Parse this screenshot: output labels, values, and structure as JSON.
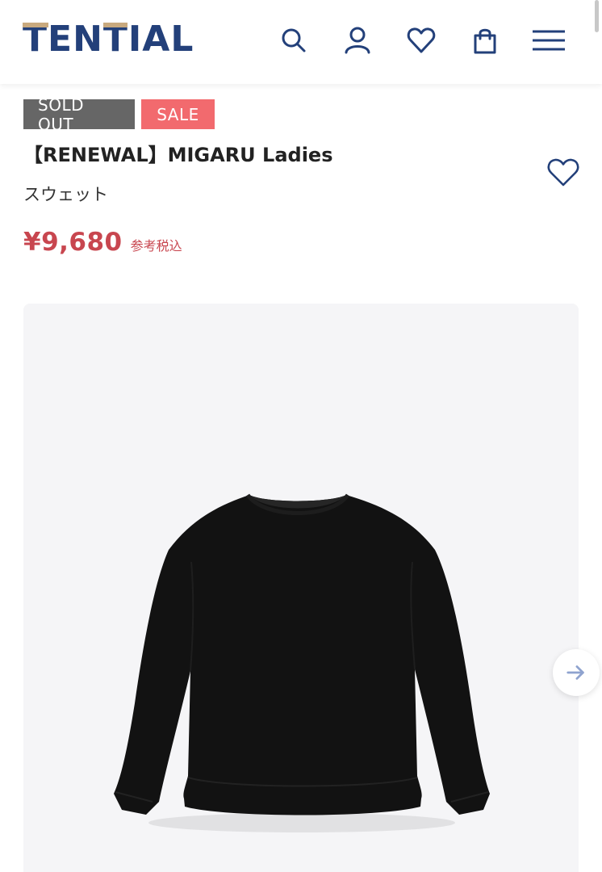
{
  "header": {
    "logo_text": "TENTIAL",
    "brand_color": "#23407a",
    "accent_color": "#c8a97e",
    "icons": [
      "search-icon",
      "account-icon",
      "heart-icon",
      "shopping-bag-icon",
      "menu-icon"
    ]
  },
  "product": {
    "badges": {
      "sold_out": "SOLD OUT",
      "sale": "SALE"
    },
    "title": "【RENEWAL】MIGARU Ladies",
    "category": "スウェット",
    "price": "¥9,680",
    "tax_note": "参考税込",
    "price_color": "#c8464f",
    "sale_color": "#f26a6e"
  },
  "gallery": {
    "image": "black-sweatshirt",
    "next_icon": "arrow-right-icon"
  }
}
